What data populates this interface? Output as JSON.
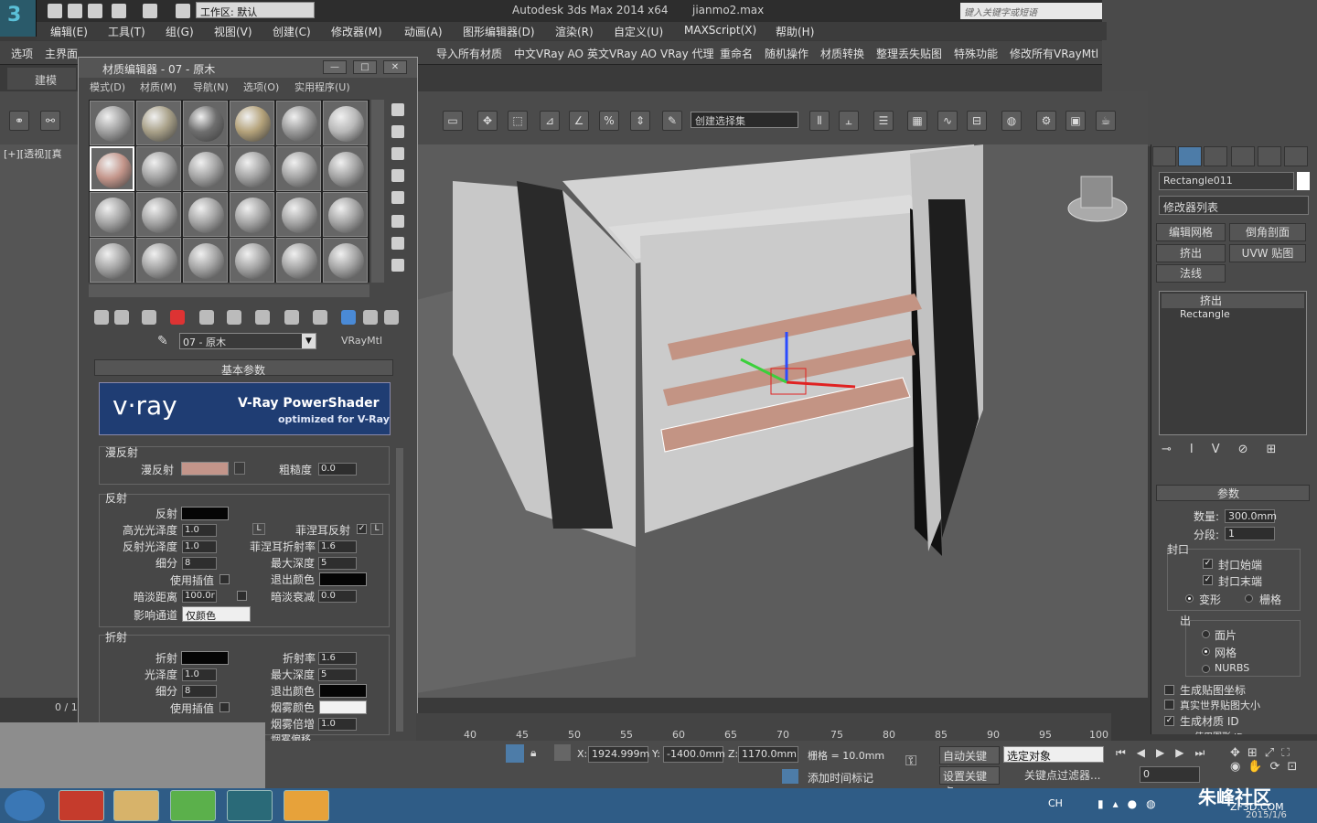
{
  "app": {
    "title": "Autodesk 3ds Max  2014 x64",
    "file": "jianmo2.max",
    "workspace": "工作区: 默认",
    "search_placeholder": "键入关键字或短语"
  },
  "menu": [
    "编辑(E)",
    "工具(T)",
    "组(G)",
    "视图(V)",
    "创建(C)",
    "修改器(M)",
    "动画(A)",
    "图形编辑器(D)",
    "渲染(R)",
    "自定义(U)",
    "MAXScript(X)",
    "帮助(H)"
  ],
  "toolbar2": [
    "选项",
    "主界面",
    "导入所有材质",
    "中文VRay AO",
    "英文VRay AO",
    "VRay 代理",
    "重命名",
    "随机操作",
    "材质转换",
    "整理丢失贴图",
    "特殊功能",
    "修改所有VRayMtl"
  ],
  "ribbon_tab": "建模",
  "selection_set": "创建选择集",
  "viewport_label": "[+][透视][真",
  "left_counter": "0 / 1",
  "material_editor": {
    "title": "材质编辑器 - 07 - 原木",
    "menu": [
      "模式(D)",
      "材质(M)",
      "导航(N)",
      "选项(O)",
      "实用程序(U)"
    ],
    "material_name": "07 - 原木",
    "material_type": "VRayMtl",
    "basic_params": "基本参数",
    "vray_logo": "v·ray",
    "vray_title": "V-Ray PowerShader",
    "vray_subtitle": "optimized for V-Ray",
    "diffuse_group": "漫反射",
    "diffuse_label": "漫反射",
    "roughness_label": "粗糙度",
    "roughness": "0.0",
    "reflection_group": "反射",
    "reflect_label": "反射",
    "hilight_gloss_label": "高光光泽度",
    "hilight_gloss": "1.0",
    "refl_gloss_label": "反射光泽度",
    "refl_gloss": "1.0",
    "subdivs_label": "细分",
    "subdivs": "8",
    "use_interp_label": "使用插值",
    "dim_dist_label": "暗淡距离",
    "dim_dist": "100.0r",
    "affect_channels_label": "影响通道",
    "affect_channels": "仅颜色",
    "fresnel_label": "菲涅耳反射",
    "fresnel_ior_label": "菲涅耳折射率",
    "fresnel_ior": "1.6",
    "max_depth_label": "最大深度",
    "max_depth": "5",
    "exit_color_label": "退出颜色",
    "dim_falloff_label": "暗淡衰减",
    "dim_falloff": "0.0",
    "l_label": "L",
    "refraction_group": "折射",
    "refract_label": "折射",
    "gloss_label": "光泽度",
    "gloss": "1.0",
    "r_subdivs": "8",
    "r_use_interp_label": "使用插值",
    "ior_label": "折射率",
    "ior": "1.6",
    "r_max_depth_label": "最大深度",
    "r_max_depth": "5",
    "r_exit_color_label": "退出颜色",
    "fog_color_label": "烟雾颜色",
    "fog_mult_label": "烟雾倍增",
    "fog_mult": "1.0",
    "fog_bias_label": "烟雾偏移",
    "colors": {
      "diffuse": "#c3958a",
      "black": "#050505",
      "white": "#f2f2f2"
    }
  },
  "command_panel": {
    "object_name": "Rectangle011",
    "modifier_list": "修改器列表",
    "buttons": [
      "编辑网格",
      "倒角剖面",
      "挤出",
      "UVW 贴图",
      "法线"
    ],
    "stack": [
      "挤出",
      "Rectangle"
    ],
    "params_title": "参数",
    "amount_label": "数量:",
    "amount": "300.0mm",
    "segments_label": "分段:",
    "segments": "1",
    "capping": "封口",
    "cap_start": "封口始端",
    "cap_end": "封口末端",
    "morph": "变形",
    "grid": "栅格",
    "output": "出",
    "patch": "面片",
    "mesh": "网格",
    "nurbs": "NURBS",
    "gen_map": "生成贴图坐标",
    "real_world": "真实世界贴图大小",
    "gen_matid": "生成材质 ID",
    "use_shape_id": "使用图形 ID"
  },
  "timeline_ticks": [
    "40",
    "45",
    "50",
    "55",
    "60",
    "65",
    "70",
    "75",
    "80",
    "85",
    "90",
    "95",
    "100"
  ],
  "status": {
    "x_label": "X:",
    "x": "1924.999m",
    "y_label": "Y:",
    "y": "-1400.0mm",
    "z_label": "Z:",
    "z": "1170.0mm",
    "grid": "栅格 = 10.0mm",
    "auto_key": "自动关键点",
    "selected": "选定对象",
    "set_key": "设置关键点",
    "key_filters": "关键点过滤器...",
    "add_time_tag": "添加时间标记",
    "frame": "0"
  },
  "taskbar": {
    "lang": "CH"
  },
  "watermark": {
    "main": "朱峰社区",
    "sub": "ZF3D.COM",
    "date": "2015/1/6"
  }
}
